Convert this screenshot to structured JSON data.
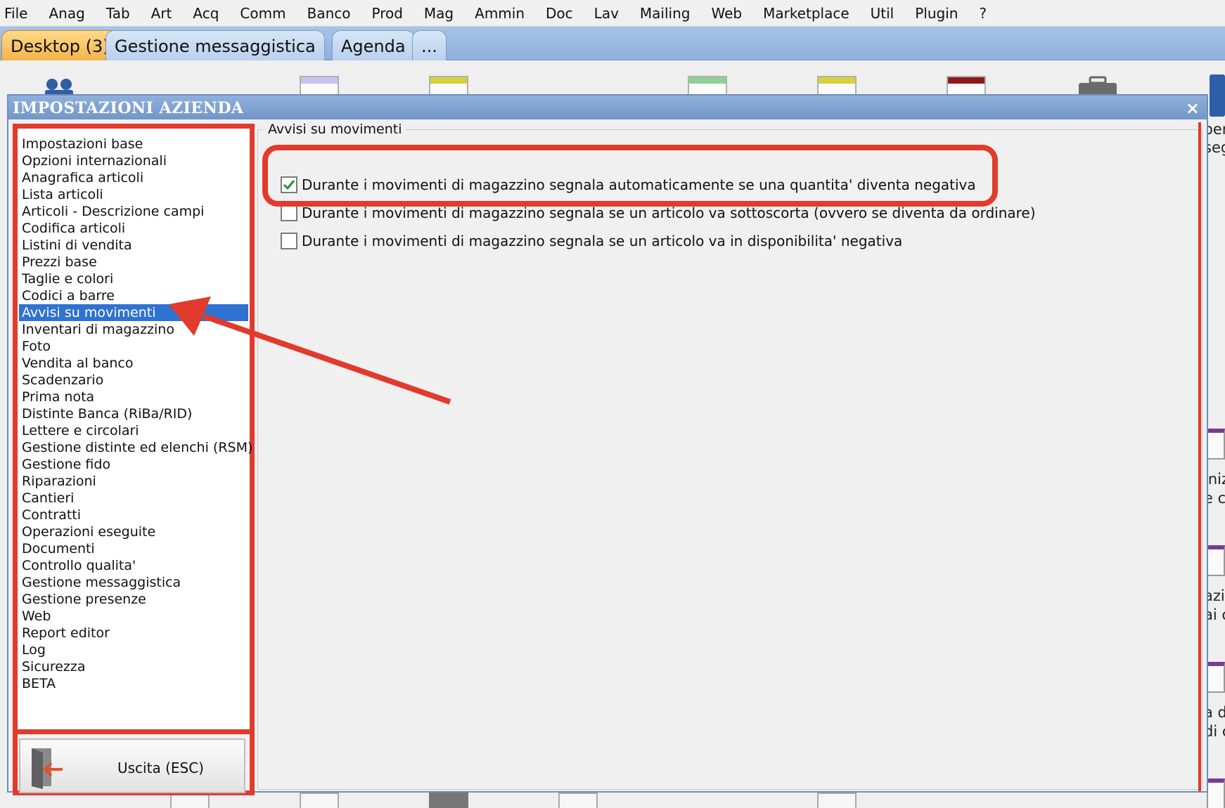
{
  "menu": [
    "File",
    "Anag",
    "Tab",
    "Art",
    "Acq",
    "Comm",
    "Banco",
    "Prod",
    "Mag",
    "Ammin",
    "Doc",
    "Lav",
    "Mailing",
    "Web",
    "Marketplace",
    "Util",
    "Plugin",
    "?"
  ],
  "tabs": [
    {
      "label": "Desktop (3)",
      "active": true
    },
    {
      "label": "Gestione messaggistica",
      "active": false
    },
    {
      "label": "Agenda",
      "active": false
    },
    {
      "label": "...",
      "active": false
    }
  ],
  "background_text": {
    "fragment_1": "oer",
    "fragment_2": "seg",
    "fragment_3": "iniz",
    "fragment_4": "e c",
    "fragment_5": "azio",
    "fragment_6": "ai cl",
    "fragment_7": "a d",
    "fragment_8": "di c"
  },
  "dialog": {
    "title": "IMPOSTAZIONI AZIENDA",
    "close_symbol": "×",
    "sections": [
      "Impostazioni base",
      "Opzioni internazionali",
      "Anagrafica articoli",
      "Lista articoli",
      "Articoli - Descrizione campi",
      "Codifica articoli",
      "Listini di vendita",
      "Prezzi base",
      "Taglie e colori",
      "Codici a barre",
      "Avvisi su movimenti",
      "Inventari di magazzino",
      "Foto",
      "Vendita al banco",
      "Scadenzario",
      "Prima nota",
      "Distinte Banca (RiBa/RID)",
      "Lettere e circolari",
      "Gestione distinte ed elenchi (RSM)",
      "Gestione fido",
      "Riparazioni",
      "Cantieri",
      "Contratti",
      "Operazioni eseguite",
      "Documenti",
      "Controllo qualita'",
      "Gestione messaggistica",
      "Gestione presenze",
      "Web",
      "Report editor",
      "Log",
      "Sicurezza",
      "BETA"
    ],
    "selected_section": "Avvisi su movimenti",
    "exit_label": "Uscita (ESC)",
    "exit_icon": "exit-door-icon",
    "group_title": "Avvisi su movimenti",
    "options": [
      {
        "label": "Durante i movimenti di magazzino segnala automaticamente se una quantita' diventa negativa",
        "checked": true
      },
      {
        "label": "Durante i movimenti di magazzino segnala se un articolo va sottoscorta (ovvero se diventa da ordinare)",
        "checked": false
      },
      {
        "label": "Durante i movimenti di magazzino segnala se un articolo va in disponibilita' negativa",
        "checked": false
      }
    ]
  },
  "colors": {
    "annotation_red": "#e23a2c",
    "selection_blue": "#2f72d1",
    "title_bar_blue": "#7296c8",
    "active_tab_orange": "#f3b449"
  }
}
